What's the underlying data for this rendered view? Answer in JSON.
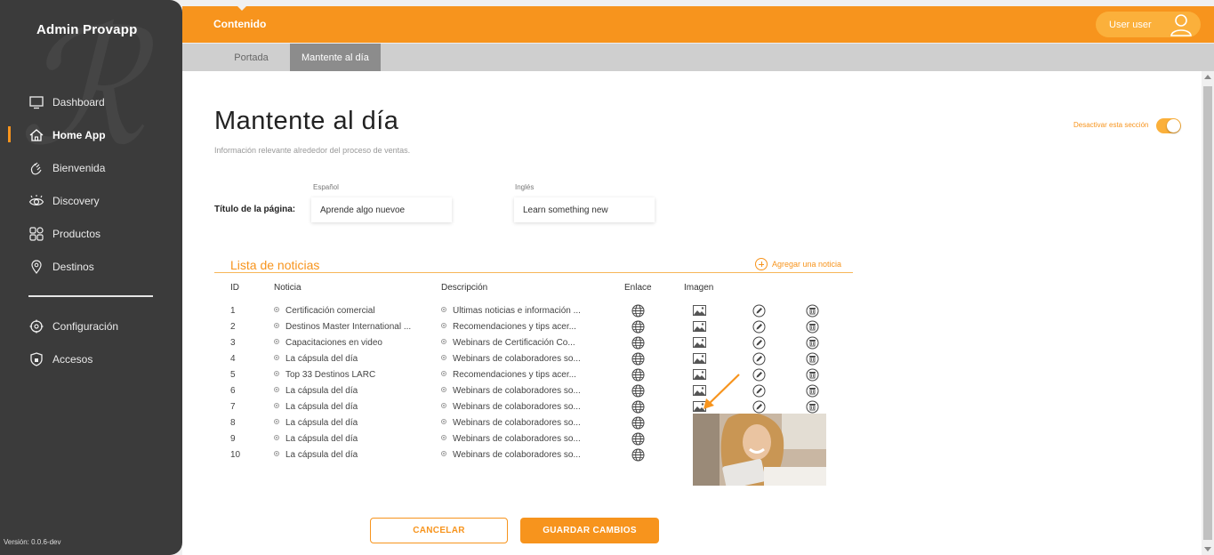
{
  "sidebar": {
    "brand": "Admin Provapp",
    "items": [
      {
        "label": "Dashboard",
        "icon": "monitor-icon"
      },
      {
        "label": "Home App",
        "icon": "home-icon",
        "active": true
      },
      {
        "label": "Bienvenida",
        "icon": "wave-hand-icon"
      },
      {
        "label": "Discovery",
        "icon": "eye-icon"
      },
      {
        "label": "Productos",
        "icon": "grid-icon"
      },
      {
        "label": "Destinos",
        "icon": "map-pin-icon"
      }
    ],
    "items2": [
      {
        "label": "Configuración",
        "icon": "gear-icon"
      },
      {
        "label": "Accesos",
        "icon": "shield-icon"
      }
    ],
    "version": "Versión: 0.0.6-dev"
  },
  "topbar": {
    "title": "Contenido",
    "user": "User user"
  },
  "tabs": [
    "Portada",
    "Mantente al día"
  ],
  "main": {
    "title": "Mantente al día",
    "subtitle": "Información relevante alrededor del proceso de ventas.",
    "toggle_label": "Desactivar esta sección",
    "lang_es": "Español",
    "lang_en": "Inglés",
    "page_title_label": "Título de la página:",
    "title_es": "Aprende algo nuevoe",
    "title_en": "Learn something new",
    "list_title": "Lista de noticias",
    "add_label": "Agregar una noticia",
    "columns": {
      "id": "ID",
      "noticia": "Noticia",
      "descripcion": "Descripción",
      "enlace": "Enlace",
      "imagen": "Imagen"
    },
    "rows": [
      {
        "id": "1",
        "noticia": "Certificación comercial",
        "descripcion": "Últimas noticias e información ...",
        "has_image": true
      },
      {
        "id": "2",
        "noticia": "Destinos Master International ...",
        "descripcion": "Recomendaciones y tips acer...",
        "has_image": true
      },
      {
        "id": "3",
        "noticia": "Capacitaciones en video",
        "descripcion": "Webinars de Certificación Co...",
        "has_image": true
      },
      {
        "id": "4",
        "noticia": "La cápsula del día",
        "descripcion": "Webinars de colaboradores so...",
        "has_image": true
      },
      {
        "id": "5",
        "noticia": "Top 33 Destinos LARC",
        "descripcion": "Recomendaciones y tips acer...",
        "has_image": true
      },
      {
        "id": "6",
        "noticia": "La cápsula del día",
        "descripcion": "Webinars de colaboradores so...",
        "has_image": true
      },
      {
        "id": "7",
        "noticia": "La cápsula del día",
        "descripcion": "Webinars de colaboradores so...",
        "has_image": true
      },
      {
        "id": "8",
        "noticia": "La cápsula del día",
        "descripcion": "Webinars de colaboradores so...",
        "has_image": false
      },
      {
        "id": "9",
        "noticia": "La cápsula del día",
        "descripcion": "Webinars de colaboradores so...",
        "has_image": false
      },
      {
        "id": "10",
        "noticia": "La cápsula del día",
        "descripcion": "Webinars de colaboradores so...",
        "has_image": false
      }
    ],
    "cancel": "CANCELAR",
    "save": "GUARDAR CAMBIOS"
  },
  "colors": {
    "accent": "#f7941d",
    "sidebar": "#3b3b3b"
  }
}
